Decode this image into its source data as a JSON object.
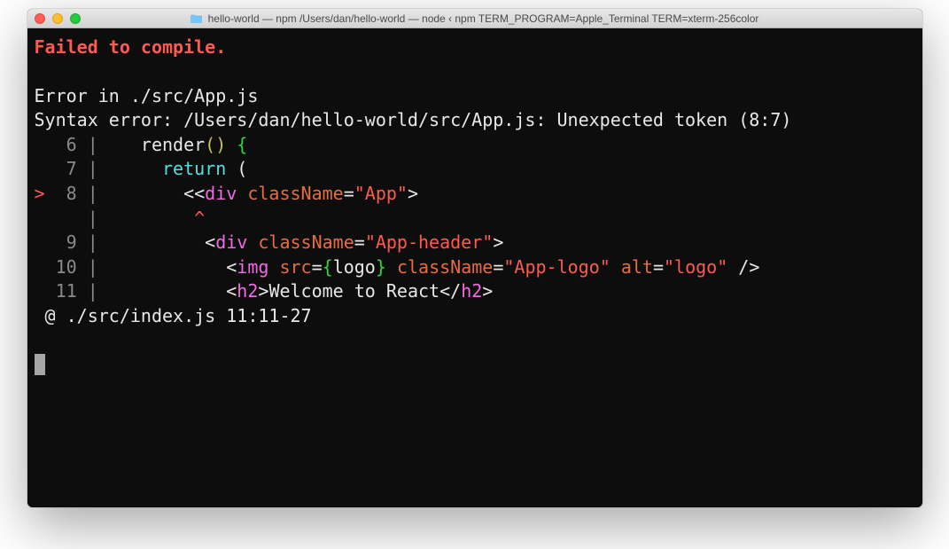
{
  "window": {
    "title": "hello-world — npm  /Users/dan/hello-world — node ‹ npm TERM_PROGRAM=Apple_Terminal TERM=xterm-256color"
  },
  "terminal": {
    "fail_header": "Failed to compile.",
    "error_in": "Error in ./src/App.js",
    "syntax_error": "Syntax error: /Users/dan/hello-world/src/App.js: Unexpected token (8:7)",
    "line6": {
      "gutter": "   6 | ",
      "pre": "   render",
      "paren_open": "(",
      "paren_close": ")",
      "brace": " {"
    },
    "line7": {
      "gutter": "   7 | ",
      "pre": "     ",
      "return": "return",
      "post": " ("
    },
    "line8": {
      "marker": ">",
      "gutter": "  8 | ",
      "pre": "       <<",
      "div": "div",
      "sp": " ",
      "attr": "className",
      "eq": "=",
      "val": "\"App\"",
      "gt": ">"
    },
    "caret": {
      "gutter": "     | ",
      "spaces": "        ",
      "caret": "^"
    },
    "line9": {
      "gutter": "   9 | ",
      "pre": "         <",
      "div": "div",
      "sp": " ",
      "attr": "className",
      "eq": "=",
      "val": "\"App-header\"",
      "gt": ">"
    },
    "line10": {
      "gutter": "  10 | ",
      "pre": "           <",
      "img": "img",
      "sp": " ",
      "attr1": "src",
      "eq1": "=",
      "bro": "{",
      "logo": "logo",
      "brc": "}",
      "sp2": " ",
      "attr2": "className",
      "eq2": "=",
      "val2": "\"App-logo\"",
      "sp3": " ",
      "attr3": "alt",
      "eq3": "=",
      "val3": "\"logo\"",
      "close": " />"
    },
    "line11": {
      "gutter": "  11 | ",
      "pre": "           <",
      "h2": "h2",
      "gt": ">",
      "text": "Welcome to React",
      "lt": "</",
      "h2c": "h2",
      "gt2": ">"
    },
    "footer": " @ ./src/index.js 11:11-27"
  }
}
